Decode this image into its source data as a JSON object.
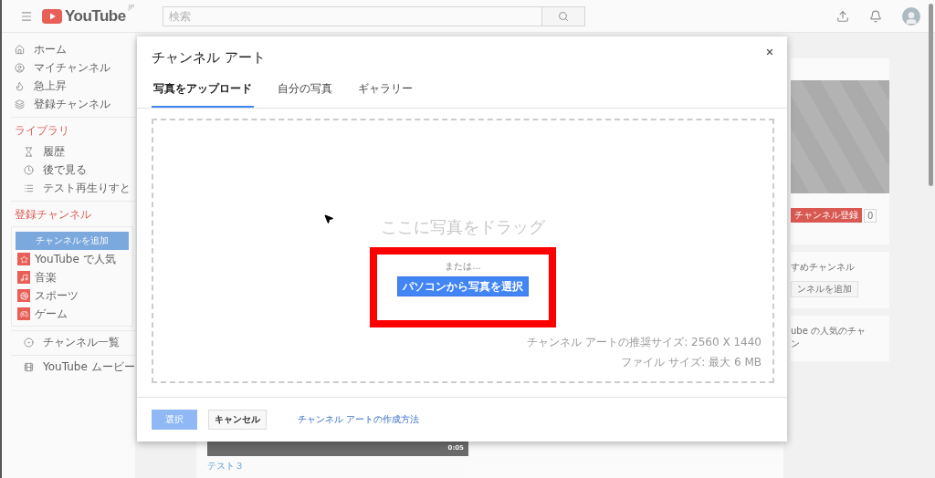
{
  "header": {
    "logo": "YouTube",
    "region": "JP",
    "search_placeholder": "検索"
  },
  "sidebar": {
    "main": [
      {
        "label": "ホーム"
      },
      {
        "label": "マイチャンネル"
      },
      {
        "label": "急上昇"
      },
      {
        "label": "登録チャンネル"
      }
    ],
    "library_heading": "ライブラリ",
    "library": [
      {
        "label": "履歴"
      },
      {
        "label": "後で見る"
      },
      {
        "label": "テスト再生りすと"
      }
    ],
    "subscriptions_heading": "登録チャンネル",
    "add_channel": "チャンネルを追加",
    "subscriptions": [
      {
        "label": "YouTube で人気"
      },
      {
        "label": "音楽"
      },
      {
        "label": "スポーツ"
      },
      {
        "label": "ゲーム"
      }
    ],
    "bottom": [
      {
        "label": "チャンネル一覧"
      },
      {
        "label": "YouTube ムービー"
      }
    ]
  },
  "right": {
    "subscribe": "チャンネル登録",
    "subscriber_count": "0",
    "recommended_title": "すめチャンネル",
    "recommended_button": "ンネルを追加",
    "popular_title": "ube の人気のチャ",
    "popular_title_2": "ン"
  },
  "video": {
    "duration": "0:05",
    "title": "テスト３"
  },
  "dialog": {
    "title": "チャンネル アート",
    "tabs": [
      {
        "label": "写真をアップロード",
        "selected": true
      },
      {
        "label": "自分の写真",
        "selected": false
      },
      {
        "label": "ギャラリー",
        "selected": false
      }
    ],
    "drop_text": "ここに写真をドラッグ",
    "or_text": "または...",
    "upload_button": "パソコンから写真を選択",
    "size_note": "チャンネル アートの推奨サイズ: 2560 X 1440",
    "file_note": "ファイル サイズ: 最大 6 MB",
    "select_button": {
      "label": "選択",
      "disabled": true
    },
    "cancel_button": "キャンセル",
    "help_link": "チャンネル アートの作成方法"
  }
}
